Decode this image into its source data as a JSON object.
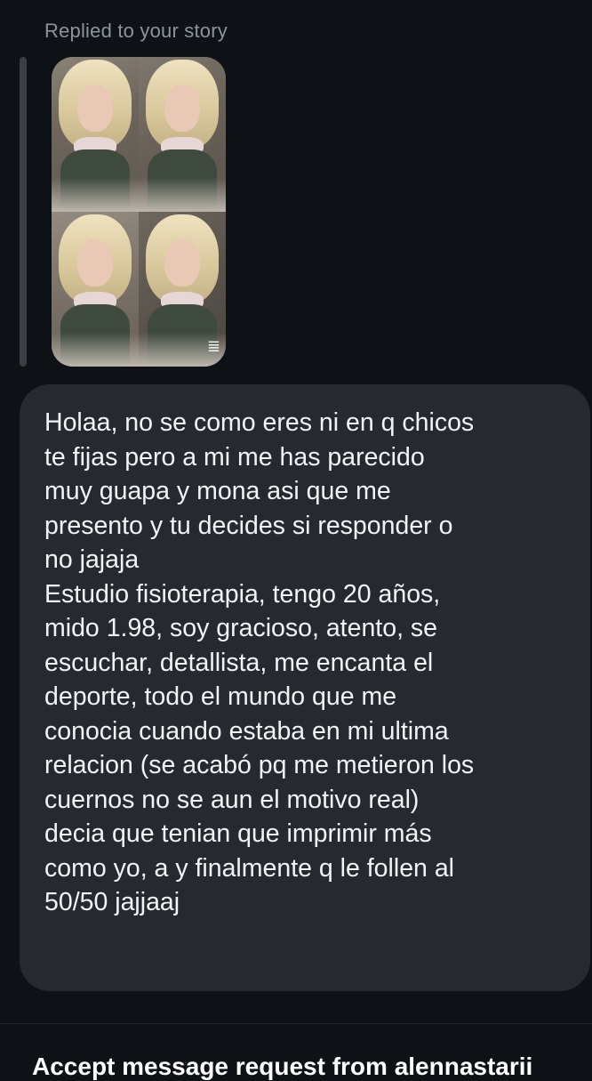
{
  "story_reply": {
    "label": "Replied to your story",
    "thumbnail_icon": "story-photo-collage",
    "sticker_icon": "sticker-icon"
  },
  "message": {
    "text": "Holaa, no se como eres ni en q chicos\nte fijas pero a mi me has parecido\nmuy guapa y mona asi que me\npresento y tu decides si responder o\nno jajaja\nEstudio fisioterapia, tengo 20 años,\nmido 1.98, soy gracioso, atento, se\nescuchar, detallista, me encanta el\ndeporte, todo el mundo que me\nconocia cuando estaba en mi ultima\nrelacion (se acabó pq me metieron los\ncuernos no se aun el motivo real)\ndecia que tenian que imprimir más\ncomo yo, a y finalmente q le follen al\n50/50 jajjaaj"
  },
  "footer": {
    "accept_label": "Accept message request from alennastarii"
  },
  "colors": {
    "background": "#0e1116",
    "bubble": "#262a30",
    "muted_text": "#8e949c",
    "text": "#f2f3f5"
  }
}
